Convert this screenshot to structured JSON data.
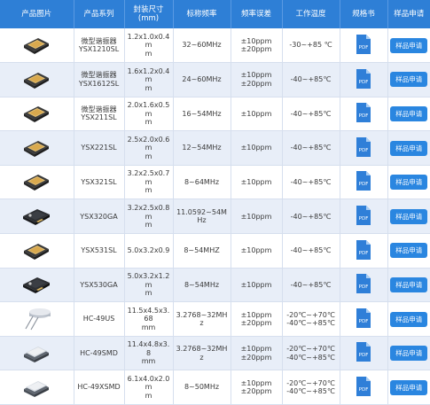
{
  "headers": [
    "产品图片",
    "产品系列",
    "封装尺寸\n(mm)",
    "标称频率",
    "频率误差",
    "工作温度",
    "规格书",
    "样品申请"
  ],
  "pdf_label": "PDF",
  "button_label": "样品申请",
  "rows": [
    {
      "series": "微型谐振器\nYSX1210SL",
      "size": "1.2x1.0x0.4m\nm",
      "freq": "32~60MHz",
      "tol": [
        "±10ppm",
        "±20ppm"
      ],
      "temp": [
        "-30~+85 ℃"
      ],
      "img": "gold"
    },
    {
      "series": "微型谐振器\nYSX1612SL",
      "size": "1.6x1.2x0.4m\nm",
      "freq": "24~60MHz",
      "tol": [
        "±10ppm",
        "±20ppm"
      ],
      "temp": [
        "-40~+85℃"
      ],
      "img": "gold"
    },
    {
      "series": "微型谐振器\nYSX211SL",
      "size": "2.0x1.6x0.5m\nm",
      "freq": "16~54MHz",
      "tol": [
        "±10ppm"
      ],
      "temp": [
        "-40~+85℃"
      ],
      "img": "gold"
    },
    {
      "series": "YSX221SL",
      "size": "2.5x2.0x0.6m\nm",
      "freq": "12~54MHz",
      "tol": [
        "±10ppm"
      ],
      "temp": [
        "-40~+85℃"
      ],
      "img": "gold"
    },
    {
      "series": "YSX321SL",
      "size": "3.2x2.5x0.7m\nm",
      "freq": "8~64MHz",
      "tol": [
        "±10ppm"
      ],
      "temp": [
        "-40~+85℃"
      ],
      "img": "gold"
    },
    {
      "series": "YSX320GA",
      "size": "3.2x2.5x0.8m\nm",
      "freq": "11.0592~54M\nHz",
      "tol": [
        "±10ppm"
      ],
      "temp": [
        "-40~+85℃"
      ],
      "img": "dark"
    },
    {
      "series": "YSX531SL",
      "size": "5.0x3.2x0.9",
      "freq": "8~54MHZ",
      "tol": [
        "±10ppm"
      ],
      "temp": [
        "-40~+85℃"
      ],
      "img": "gold"
    },
    {
      "series": "YSX530GA",
      "size": "5.0x3.2x1.2m\nm",
      "freq": "8~54MHz",
      "tol": [
        "±10ppm"
      ],
      "temp": [
        "-40~+85℃"
      ],
      "img": "dark"
    },
    {
      "series": "HC-49US",
      "size": "11.5x4.5x3.68\nmm",
      "freq": "3.2768~32MH\nz",
      "tol": [
        "±10ppm",
        "±20ppm"
      ],
      "temp": [
        "-20℃~+70℃",
        "-40℃~+85℃"
      ],
      "img": "legs"
    },
    {
      "series": "HC-49SMD",
      "size": "11.4x4.8x3.8\nmm",
      "freq": "3.2768~32MH\nz",
      "tol": [
        "±10ppm",
        "±20ppm"
      ],
      "temp": [
        "-20℃~+70℃",
        "-40℃~+85℃"
      ],
      "img": "smd"
    },
    {
      "series": "HC-49XSMD",
      "size": "6.1x4.0x2.0m\nm",
      "freq": "8~50MHz",
      "tol": [
        "±10ppm",
        "±20ppm"
      ],
      "temp": [
        "-20℃~+70℃",
        "-40℃~+85℃"
      ],
      "img": "smd"
    }
  ],
  "colors": {
    "header": "#2e7fd6",
    "row_alt": "#e8eef8",
    "button": "#2a86e0",
    "pdf": "#2f7fd8"
  }
}
